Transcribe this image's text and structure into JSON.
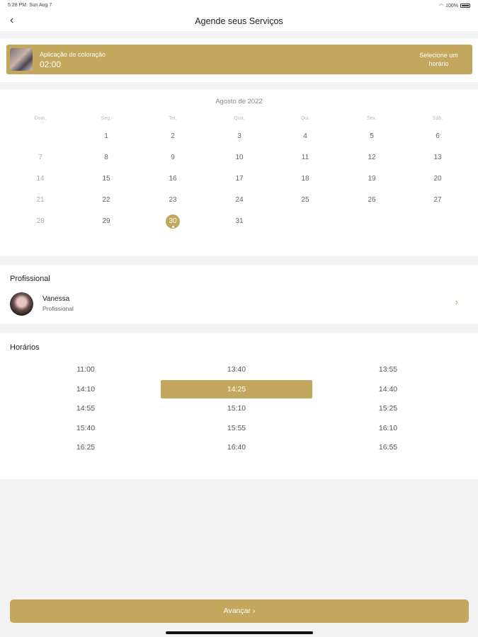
{
  "status": {
    "time": "5:28 PM",
    "date": "Sun Aug 7",
    "battery": "100%"
  },
  "nav": {
    "back_icon": "‹",
    "title": "Agende seus Serviços"
  },
  "service": {
    "name": "Aplicação de coloração",
    "duration": "02:00",
    "action_line1": "Selecione um",
    "action_line2": "horário"
  },
  "calendar": {
    "month": "Agosto de 2022",
    "weekdays": [
      "Dom.",
      "Seg.",
      "Ter.",
      "Qua.",
      "Qui.",
      "Sex.",
      "Sáb."
    ],
    "weeks": [
      [
        "",
        "1",
        "2",
        "3",
        "4",
        "5",
        "6"
      ],
      [
        "7",
        "8",
        "9",
        "10",
        "11",
        "12",
        "13"
      ],
      [
        "14",
        "15",
        "16",
        "17",
        "18",
        "19",
        "20"
      ],
      [
        "21",
        "22",
        "23",
        "24",
        "25",
        "26",
        "27"
      ],
      [
        "28",
        "29",
        "30",
        "31",
        "",
        "",
        ""
      ]
    ],
    "selected_day": "30",
    "accent_color": "#c2a75c"
  },
  "professional": {
    "section_title": "Profissional",
    "name": "Vanessa",
    "role": "Profissional",
    "chevron_icon": "›"
  },
  "horarios": {
    "section_title": "Horários",
    "rows": [
      [
        "11:00",
        "13:40",
        "13:55"
      ],
      [
        "14:10",
        "14:25",
        "14:40"
      ],
      [
        "14:55",
        "15:10",
        "15:25"
      ],
      [
        "15:40",
        "15:55",
        "16:10"
      ],
      [
        "16:25",
        "16:40",
        "16:55"
      ]
    ],
    "selected": "14:25"
  },
  "footer": {
    "button_label": "Avançar  ›"
  }
}
